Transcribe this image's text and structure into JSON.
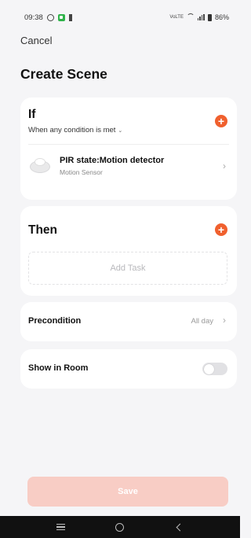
{
  "status_bar": {
    "time": "09:38",
    "network_label": "VoLTE",
    "battery": "86%"
  },
  "header": {
    "cancel_label": "Cancel",
    "title": "Create Scene"
  },
  "if_section": {
    "title": "If",
    "condition_mode": "When any condition is met",
    "conditions": [
      {
        "title": "PIR state:Motion detector",
        "subtitle": "Motion Sensor"
      }
    ]
  },
  "then_section": {
    "title": "Then",
    "add_task_label": "Add Task"
  },
  "precondition": {
    "label": "Precondition",
    "value": "All day"
  },
  "show_in_room": {
    "label": "Show in Room",
    "enabled": false
  },
  "save_label": "Save",
  "colors": {
    "accent": "#f0602e",
    "save_disabled": "#f8cdc5",
    "background": "#f5f5f7"
  },
  "icons": {
    "add": "plus-circle-icon",
    "chevron": "chevron-right-icon",
    "sensor": "motion-sensor-icon"
  }
}
